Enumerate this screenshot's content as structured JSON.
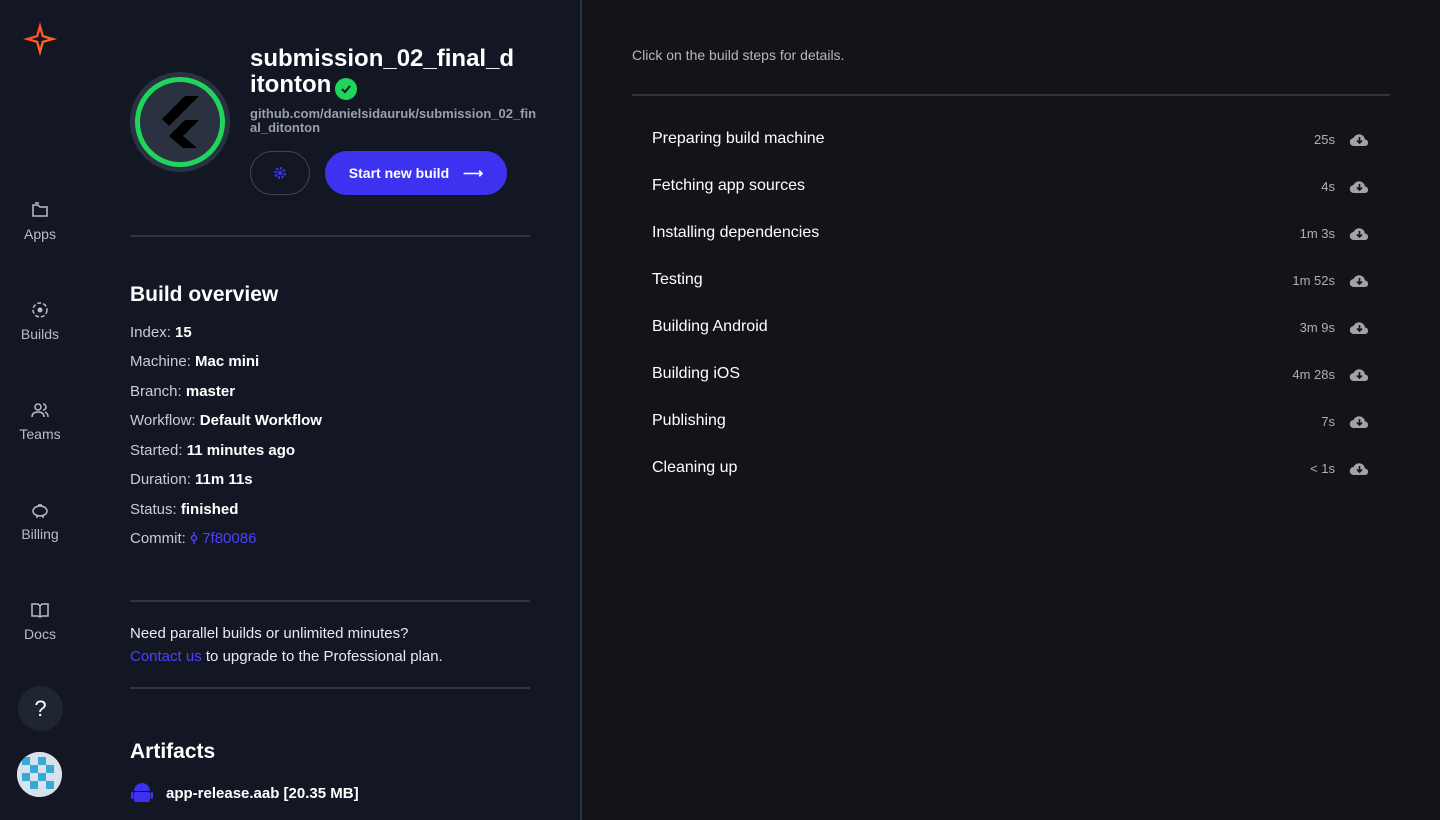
{
  "nav": {
    "items": [
      {
        "label": "Apps",
        "icon": "folder-icon"
      },
      {
        "label": "Builds",
        "icon": "builds-icon"
      },
      {
        "label": "Teams",
        "icon": "users-icon"
      },
      {
        "label": "Billing",
        "icon": "piggy-bank-icon"
      },
      {
        "label": "Docs",
        "icon": "book-icon"
      }
    ],
    "help_label": "?"
  },
  "app": {
    "title": "submission_02_final_ditonton",
    "repo": "github.com/danielsidauruk/submission_02_final_ditonton",
    "start_build_label": "Start new build",
    "arrow": "⟶"
  },
  "overview": {
    "title": "Build overview",
    "fields": [
      {
        "key": "Index:",
        "value": "15"
      },
      {
        "key": "Machine:",
        "value": "Mac mini"
      },
      {
        "key": "Branch:",
        "value": "master"
      },
      {
        "key": "Workflow:",
        "value": "Default Workflow"
      },
      {
        "key": "Started:",
        "value": "11 minutes ago"
      },
      {
        "key": "Duration:",
        "value": "11m 11s"
      },
      {
        "key": "Status:",
        "value": "finished"
      }
    ],
    "commit_key": "Commit:",
    "commit_value": "7f80086"
  },
  "promo": {
    "line1": "Need parallel builds or unlimited minutes?",
    "link": "Contact us",
    "line2": " to upgrade to the Professional plan."
  },
  "artifacts": {
    "title": "Artifacts",
    "items": [
      {
        "name": "app-release.aab [20.35 MB]"
      }
    ]
  },
  "steps": {
    "hint": "Click on the build steps for details.",
    "items": [
      {
        "name": "Preparing build machine",
        "duration": "25s"
      },
      {
        "name": "Fetching app sources",
        "duration": "4s"
      },
      {
        "name": "Installing dependencies",
        "duration": "1m 3s"
      },
      {
        "name": "Testing",
        "duration": "1m 52s"
      },
      {
        "name": "Building Android",
        "duration": "3m 9s"
      },
      {
        "name": "Building iOS",
        "duration": "4m 28s"
      },
      {
        "name": "Publishing",
        "duration": "7s"
      },
      {
        "name": "Cleaning up",
        "duration": "< 1s"
      }
    ]
  },
  "colors": {
    "accent": "#3d32f0",
    "success": "#1fd65a",
    "brand": "#f23d2e"
  }
}
